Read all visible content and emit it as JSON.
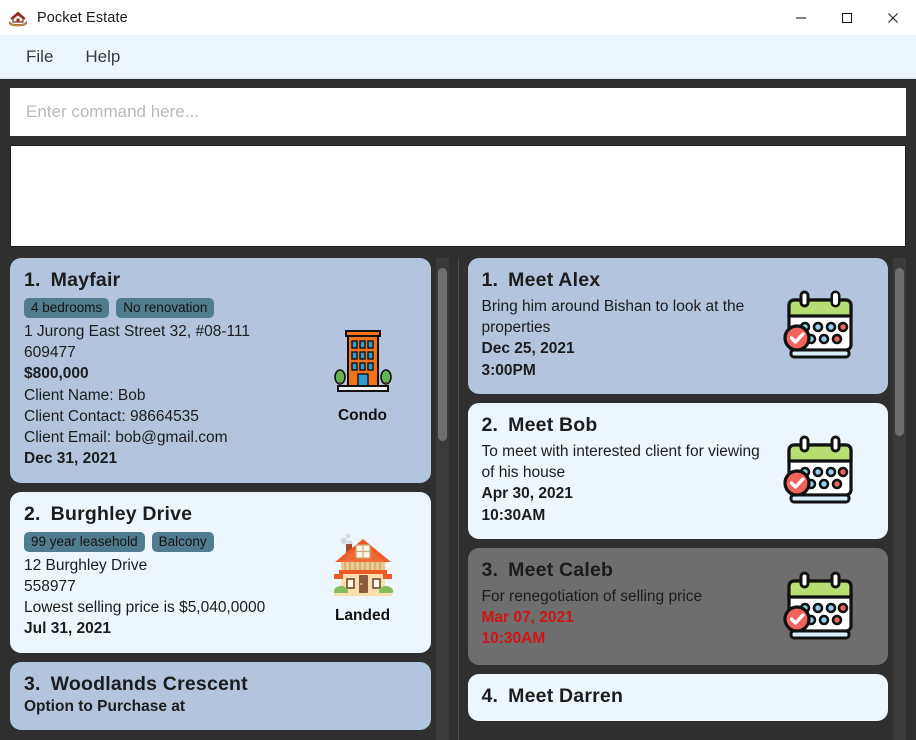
{
  "window": {
    "title": "Pocket Estate",
    "app_icon": "house-in-hand-icon",
    "minimize_label": "─",
    "maximize_label": "□",
    "close_label": "✕"
  },
  "menubar": {
    "items": [
      {
        "label": "File"
      },
      {
        "label": "Help"
      }
    ]
  },
  "command": {
    "placeholder": "Enter command here...",
    "value": ""
  },
  "result": {
    "text": ""
  },
  "colors": {
    "card_tone_a": "#b3c5de",
    "card_tone_b": "#eef6fd",
    "card_selected": "#6e6e6e",
    "tag_bg": "#517c90",
    "overdue_text": "#d01414",
    "shell_bg": "#2f2f2f",
    "menubar_bg": "#eef6fd"
  },
  "properties_panel": {
    "scroll_thumb_top_pct": 2,
    "scroll_thumb_height_pct": 36,
    "cards": [
      {
        "index": "1.",
        "name": "Mayfair",
        "tags": [
          "4 bedrooms",
          "No renovation"
        ],
        "address_line1": "1 Jurong East Street 32, #08-111",
        "address_line2": "609477",
        "price": "$800,000",
        "client_name": "Client Name: Bob",
        "client_contact": "Client Contact: 98664535",
        "client_email": "Client Email: bob@gmail.com",
        "date": "Dec 31, 2021",
        "type_label": "Condo",
        "type_icon": "condo-building-icon",
        "tone": "tone-a"
      },
      {
        "index": "2.",
        "name": "Burghley Drive",
        "tags": [
          "99 year leasehold",
          "Balcony"
        ],
        "address_line1": "12 Burghley Drive",
        "address_line2": "558977",
        "price": "Lowest selling price is $5,040,0000",
        "date": "Jul 31, 2021",
        "type_label": "Landed",
        "type_icon": "landed-house-icon",
        "tone": "tone-b"
      },
      {
        "index": "3.",
        "name": "Woodlands Crescent",
        "partial_line": "Option to Purchase at",
        "tone": "tone-a"
      }
    ]
  },
  "appointments_panel": {
    "scroll_thumb_top_pct": 2,
    "scroll_thumb_height_pct": 35,
    "cards": [
      {
        "index": "1.",
        "name": "Meet Alex",
        "description": "Bring him around Bishan to look at the properties",
        "date": "Dec 25, 2021",
        "time": "3:00PM",
        "icon": "calendar-icon",
        "tone": "tone-a",
        "overdue": false
      },
      {
        "index": "2.",
        "name": "Meet Bob",
        "description": "To meet with interested client for viewing of his house",
        "date": "Apr 30, 2021",
        "time": "10:30AM",
        "icon": "calendar-icon",
        "tone": "tone-b",
        "overdue": false
      },
      {
        "index": "3.",
        "name": "Meet Caleb",
        "description": "For renegotiation of selling price",
        "date": "Mar 07, 2021",
        "time": "10:30AM",
        "icon": "calendar-icon",
        "tone": "selected",
        "overdue": true
      },
      {
        "index": "4.",
        "name": "Meet Darren",
        "tone": "tone-b"
      }
    ]
  }
}
